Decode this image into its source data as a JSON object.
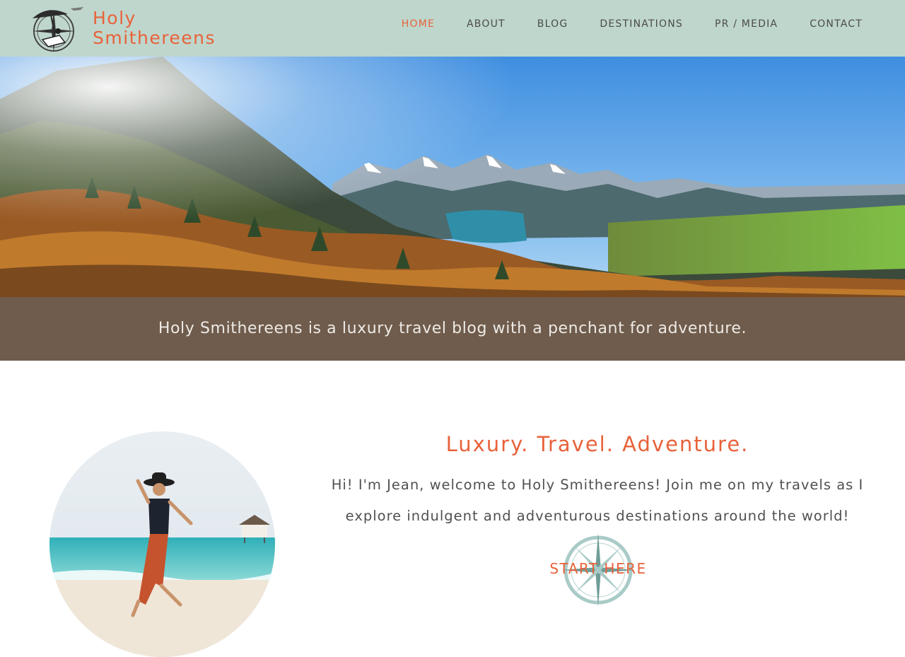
{
  "site": {
    "logo_line1": "Holy",
    "logo_line2": "Smithereens",
    "brand_color": "#e8623a",
    "header_color": "#bfd6cc"
  },
  "nav": {
    "items": [
      {
        "label": "HOME",
        "active": true
      },
      {
        "label": "ABOUT",
        "active": false
      },
      {
        "label": "BLOG",
        "active": false
      },
      {
        "label": "DESTINATIONS",
        "active": false
      },
      {
        "label": "PR / MEDIA",
        "active": false
      },
      {
        "label": "CONTACT",
        "active": false
      }
    ]
  },
  "hero": {
    "tagline": "Holy Smithereens is a luxury travel blog with a penchant for adventure."
  },
  "intro": {
    "heading": "Luxury. Travel. Adventure.",
    "body": "Hi! I'm Jean, welcome to Holy Smithereens! Join me on my travels as I explore indulgent and adventurous destinations around the world!",
    "cta_label": "START HERE"
  },
  "icons": {
    "logo": "compass-umbrella-logo-icon",
    "cta": "compass-rose-icon"
  }
}
